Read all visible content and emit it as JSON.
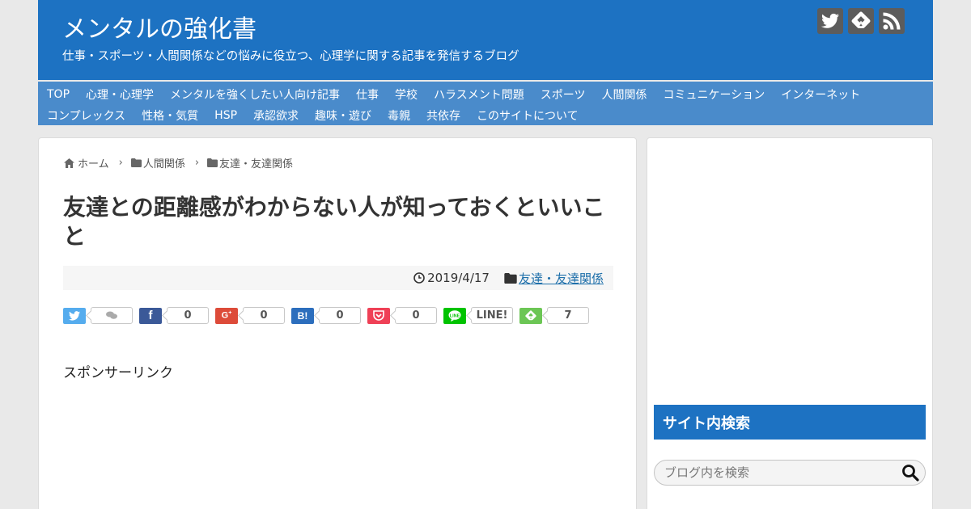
{
  "header": {
    "site_title": "メンタルの強化書",
    "site_description": "仕事・スポーツ・人間関係などの悩みに役立つ、心理学に関する記事を発信するブログ",
    "social": [
      {
        "icon": "twitter-icon",
        "color": "#5c5c5c"
      },
      {
        "icon": "feedly-icon",
        "color": "#5c5c5c"
      },
      {
        "icon": "rss-icon",
        "color": "#5c5c5c"
      }
    ]
  },
  "nav": {
    "row1": [
      "TOP",
      "心理・心理学",
      "メンタルを強くしたい人向け記事",
      "仕事",
      "学校",
      "ハラスメント問題",
      "スポーツ",
      "人間関係",
      "コミュニケーション",
      "インターネット"
    ],
    "row2": [
      "コンプレックス",
      "性格・気質",
      "HSP",
      "承認欲求",
      "趣味・遊び",
      "毒親",
      "共依存",
      "このサイトについて"
    ]
  },
  "breadcrumb": {
    "home": "ホーム",
    "cat1": "人間関係",
    "cat2": "友達・友達関係"
  },
  "post": {
    "title": "友達との距離感がわからない人が知っておくといいこと",
    "date": "2019/4/17",
    "category": "友達・友達関係",
    "sponsor_label": "スポンサーリンク"
  },
  "share": [
    {
      "icon": "twitter-icon",
      "color": "#55acee",
      "count": ""
    },
    {
      "icon": "facebook-icon",
      "color": "#3b5998",
      "count": "0"
    },
    {
      "icon": "google-plus-icon",
      "color": "#dd4b39",
      "count": "0"
    },
    {
      "icon": "hatena-bookmark-icon",
      "color": "#2c6ebd",
      "count": "0"
    },
    {
      "icon": "pocket-icon",
      "color": "#ef4056",
      "count": "0"
    },
    {
      "icon": "line-icon",
      "color": "#00c300",
      "count": "LINE!"
    },
    {
      "icon": "feedly-icon",
      "color": "#6cc655",
      "count": "7"
    }
  ],
  "sidebar": {
    "search_title": "サイト内検索",
    "search_placeholder": "ブログ内を検索"
  },
  "colors": {
    "header_bg": "#1d72c2",
    "nav_bg": "#4a8bcb",
    "link": "#1e6faa"
  }
}
